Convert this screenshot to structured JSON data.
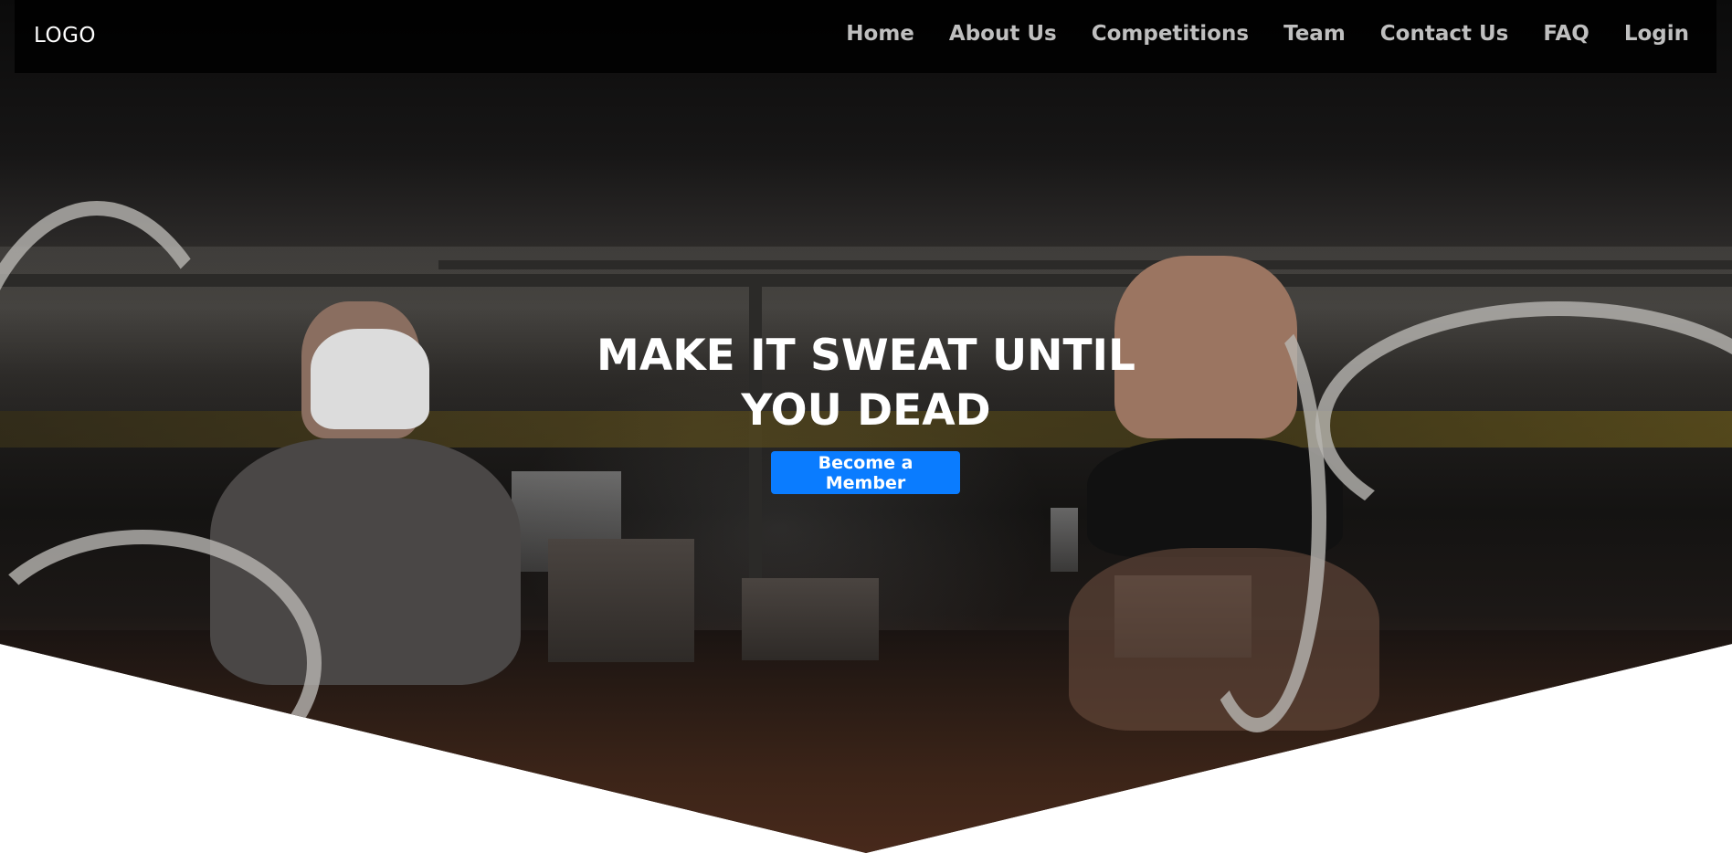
{
  "navbar": {
    "logo": "LOGO",
    "links": [
      {
        "label": "Home"
      },
      {
        "label": "About Us"
      },
      {
        "label": "Competitions"
      },
      {
        "label": "Team"
      },
      {
        "label": "Contact Us"
      },
      {
        "label": "FAQ"
      },
      {
        "label": "Login"
      }
    ]
  },
  "hero": {
    "headline": "MAKE IT SWEAT UNTIL YOU DEAD",
    "cta_label": "Become a Member"
  },
  "colors": {
    "nav_bg": "#000000",
    "nav_link": "#bfbfbf",
    "cta_bg": "#0a7cff",
    "headline": "#ffffff"
  }
}
